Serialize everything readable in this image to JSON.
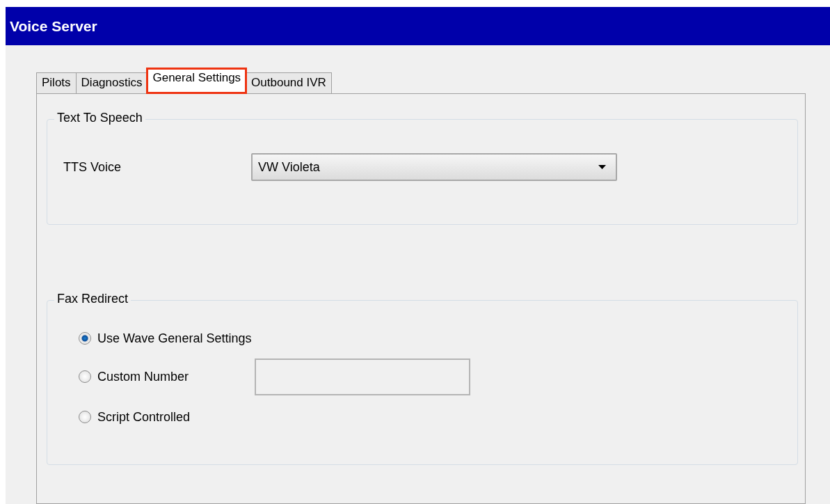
{
  "window": {
    "title": "Voice Server"
  },
  "tabs": [
    {
      "label": "Pilots",
      "selected": false,
      "highlighted": false
    },
    {
      "label": "Diagnostics",
      "selected": false,
      "highlighted": false
    },
    {
      "label": "General Settings",
      "selected": true,
      "highlighted": true
    },
    {
      "label": "Outbound IVR",
      "selected": false,
      "highlighted": false
    }
  ],
  "text_to_speech": {
    "title": "Text To Speech",
    "tts_voice": {
      "label": "TTS Voice",
      "value": "VW Violeta"
    }
  },
  "fax_redirect": {
    "title": "Fax Redirect",
    "options": [
      {
        "label": "Use Wave General Settings",
        "selected": true,
        "kind": "plain"
      },
      {
        "label": "Custom Number",
        "selected": false,
        "kind": "field"
      },
      {
        "label": "Script Controlled",
        "selected": false,
        "kind": "plain"
      }
    ]
  }
}
